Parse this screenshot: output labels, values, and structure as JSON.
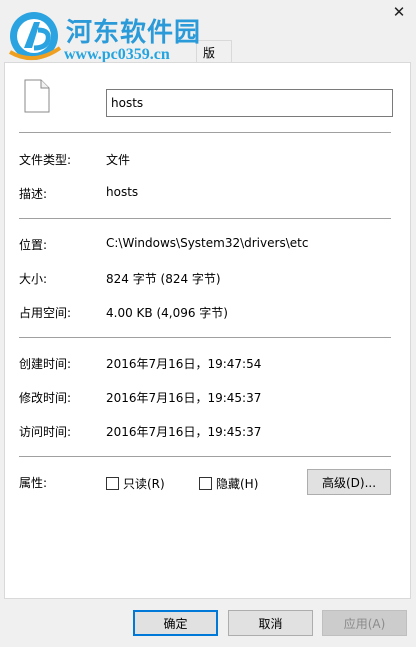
{
  "watermark": {
    "title": "河东软件园",
    "url": "www.pc0359.cn"
  },
  "window": {
    "close_glyph": "✕"
  },
  "tabs": [
    {
      "label": "版本"
    }
  ],
  "file": {
    "name": "hosts",
    "icon": "file-icon"
  },
  "properties": {
    "type_label": "文件类型:",
    "type_value": "文件",
    "desc_label": "描述:",
    "desc_value": "hosts",
    "location_label": "位置:",
    "location_value": "C:\\Windows\\System32\\drivers\\etc",
    "size_label": "大小:",
    "size_value": "824 字节 (824 字节)",
    "disk_size_label": "占用空间:",
    "disk_size_value": "4.00 KB (4,096 字节)",
    "created_label": "创建时间:",
    "created_value": "2016年7月16日，19:47:54",
    "modified_label": "修改时间:",
    "modified_value": "2016年7月16日，19:45:37",
    "accessed_label": "访问时间:",
    "accessed_value": "2016年7月16日，19:45:37",
    "attributes_label": "属性:",
    "readonly_label": "只读(R)",
    "readonly_checked": false,
    "hidden_label": "隐藏(H)",
    "hidden_checked": false,
    "advanced_label": "高级(D)..."
  },
  "footer": {
    "ok_label": "确定",
    "cancel_label": "取消",
    "apply_label": "应用(A)"
  },
  "colors": {
    "accent": "#0078d7",
    "watermark_blue": "#2a9ad8"
  }
}
